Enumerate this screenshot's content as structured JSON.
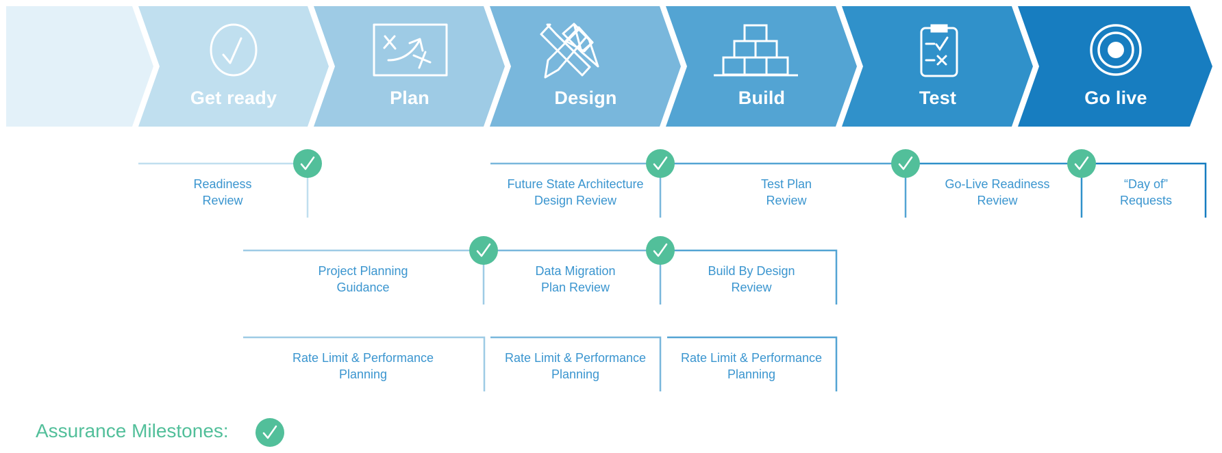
{
  "stages": [
    {
      "label": "",
      "icon": "none",
      "color": "#e3f1f9"
    },
    {
      "label": "Get ready",
      "icon": "check-circle-icon",
      "color": "#c0dfef"
    },
    {
      "label": "Plan",
      "icon": "strategy-board-icon",
      "color": "#9ecbe5"
    },
    {
      "label": "Design",
      "icon": "ruler-pencil-icon",
      "color": "#79b7dc"
    },
    {
      "label": "Build",
      "icon": "blocks-pyramid-icon",
      "color": "#53a4d3"
    },
    {
      "label": "Test",
      "icon": "clipboard-checklist-icon",
      "color": "#3091ca"
    },
    {
      "label": "Go live",
      "icon": "target-icon",
      "color": "#177dc0"
    }
  ],
  "milestone_rows": [
    {
      "items": [
        {
          "label": [
            "Readiness",
            "Review"
          ],
          "milestone": true
        },
        {
          "label": [
            "Future State Architecture",
            "Design Review"
          ],
          "milestone": true
        },
        {
          "label": [
            "Test Plan",
            "Review"
          ],
          "milestone": true
        },
        {
          "label": [
            "Go-Live Readiness",
            "Review"
          ],
          "milestone": true
        },
        {
          "label": [
            "“Day of”",
            "Requests"
          ],
          "milestone": false
        }
      ]
    },
    {
      "items": [
        {
          "label": [
            "Project Planning",
            "Guidance"
          ],
          "milestone": true
        },
        {
          "label": [
            "Data Migration",
            "Plan Review"
          ],
          "milestone": true
        },
        {
          "label": [
            "Build By Design",
            "Review"
          ],
          "milestone": false
        }
      ]
    },
    {
      "items": [
        {
          "label": [
            "Rate Limit & Performance",
            "Planning"
          ],
          "milestone": false
        },
        {
          "label": [
            "Rate Limit & Performance",
            "Planning"
          ],
          "milestone": false
        },
        {
          "label": [
            "Rate Limit & Performance",
            "Planning"
          ],
          "milestone": false
        }
      ]
    }
  ],
  "legend": {
    "label": "Assurance Milestones:",
    "icon": "check-circle-icon"
  },
  "colors": {
    "milestone_green": "#52bf9a",
    "text_blue": "#3a95cf",
    "line_light": "#a8d4ea",
    "line_dark": "#3a95cf"
  }
}
